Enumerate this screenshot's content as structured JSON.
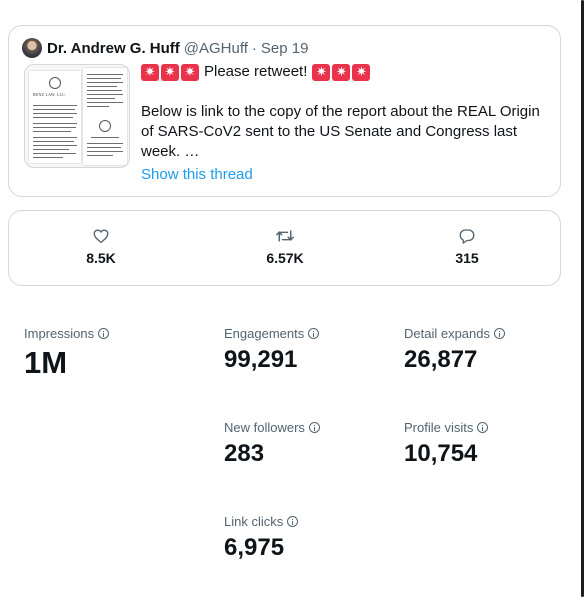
{
  "tweet": {
    "author_name": "Dr. Andrew G. Huff",
    "handle": "@AGHuff",
    "separator": "·",
    "date": "Sep 19",
    "line1": "Please retweet!",
    "body": "Below is link to the copy of the report about the REAL Origin of SARS-CoV2 sent to the US Senate and Congress last week. …",
    "show_thread": "Show this thread",
    "thumbnail": {
      "caption": "RENZ LAW, LLC."
    }
  },
  "actions": {
    "likes": "8.5K",
    "retweets": "6.57K",
    "replies": "315"
  },
  "metrics": {
    "impressions": {
      "label": "Impressions",
      "value": "1M"
    },
    "engagements": {
      "label": "Engagements",
      "value": "99,291"
    },
    "detail_expands": {
      "label": "Detail expands",
      "value": "26,877"
    },
    "new_followers": {
      "label": "New followers",
      "value": "283"
    },
    "profile_visits": {
      "label": "Profile visits",
      "value": "10,754"
    },
    "link_clicks": {
      "label": "Link clicks",
      "value": "6,975"
    }
  },
  "colors": {
    "accent": "#1d9bf0",
    "text": "#0f1419",
    "muted": "#536471",
    "border": "#cfd9de",
    "siren": "#e8334a"
  },
  "icons": [
    "heart-icon",
    "retweet-icon",
    "reply-icon",
    "info-icon",
    "siren-emoji"
  ]
}
